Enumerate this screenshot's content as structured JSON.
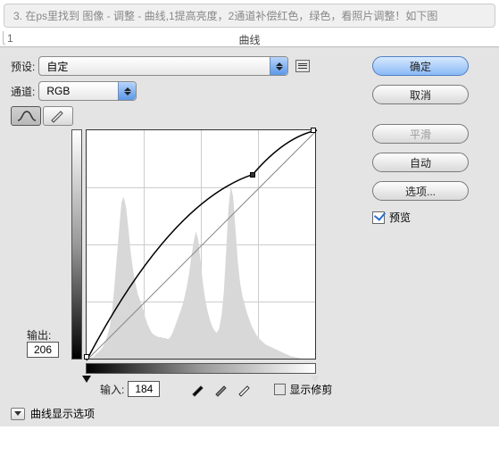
{
  "instruction": "3. 在ps里找到 图像 - 调整 - 曲线,1提高亮度，2通道补偿红色，绿色，看照片调整！如下图",
  "tab": {
    "number": "1",
    "title": "曲线"
  },
  "labels": {
    "preset": "预设:",
    "channel": "通道:",
    "output": "输出:",
    "input": "输入:",
    "show_clipping": "显示修剪",
    "curve_display_options": "曲线显示选项",
    "preview": "预览"
  },
  "preset": {
    "value": "自定"
  },
  "channel": {
    "value": "RGB"
  },
  "values": {
    "output": "206",
    "input": "184"
  },
  "buttons": {
    "ok": "确定",
    "cancel": "取消",
    "smooth": "平滑",
    "auto": "自动",
    "options": "选项..."
  },
  "chart_data": {
    "type": "curve",
    "xlim": [
      0,
      255
    ],
    "ylim": [
      0,
      255
    ],
    "baseline": [
      [
        0,
        0
      ],
      [
        255,
        255
      ]
    ],
    "curve_points": [
      [
        0,
        0
      ],
      [
        184,
        206
      ],
      [
        255,
        255
      ]
    ],
    "control_point": [
      184,
      206
    ],
    "histogram": [
      0,
      0,
      1,
      2,
      4,
      6,
      8,
      11,
      15,
      22,
      30,
      45,
      68,
      95,
      120,
      145,
      150,
      140,
      120,
      98,
      82,
      70,
      60,
      54,
      48,
      40,
      33,
      28,
      24,
      22,
      21,
      20,
      20,
      19,
      19,
      18,
      20,
      24,
      30,
      36,
      42,
      48,
      56,
      66,
      78,
      94,
      108,
      118,
      110,
      90,
      70,
      55,
      44,
      36,
      30,
      26,
      24,
      28,
      40,
      62,
      100,
      140,
      160,
      150,
      120,
      90,
      70,
      58,
      50,
      42,
      36,
      30,
      26,
      22,
      19,
      17,
      15,
      13,
      12,
      11,
      10,
      9,
      8,
      7,
      6,
      5,
      4,
      3,
      2,
      2,
      1,
      1,
      0,
      0,
      0,
      0,
      0,
      0,
      0,
      0
    ]
  }
}
